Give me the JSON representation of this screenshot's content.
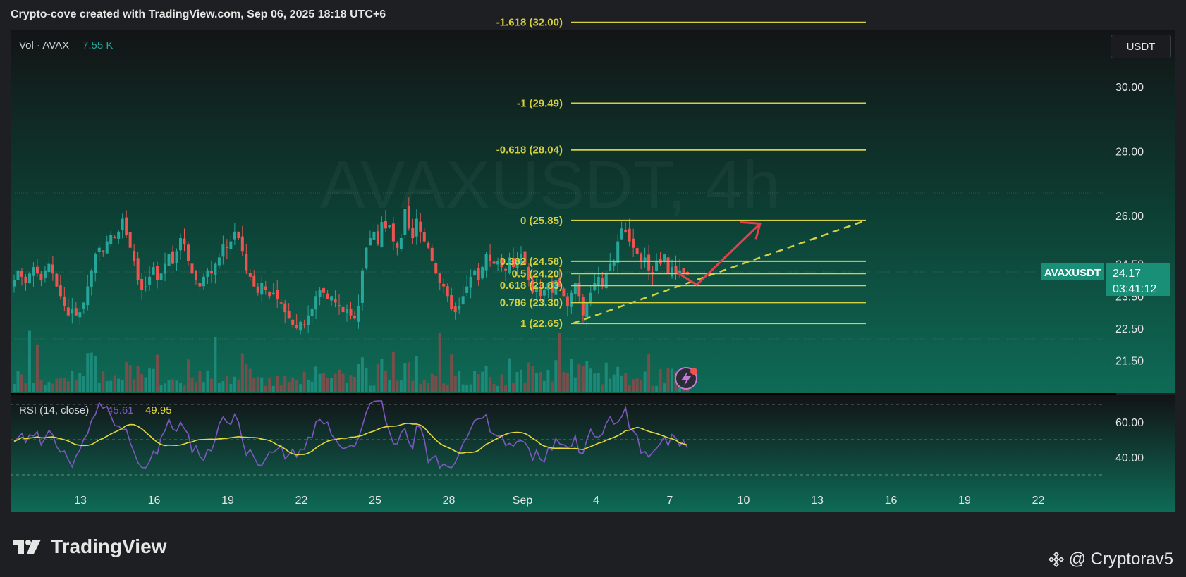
{
  "header": {
    "attribution": "Crypto-cove created with TradingView.com, Sep 06, 2025 18:18 UTC+6"
  },
  "toolbar": {
    "currency_label": "USDT"
  },
  "watermark": "AVAXUSDT, 4h",
  "colors": {
    "up": "#26a69a",
    "down": "#ef5350",
    "fib": "#d4d040",
    "fib_text": "#d4d040",
    "rsi_line": "#7e57c2",
    "rsi_ma": "#e5d83d",
    "bg_top": "#121314",
    "bg_bottom": "#0f6a55",
    "arrow": "#e0414b",
    "trend": "#d4d040"
  },
  "icons": [
    "tradingview-logo-icon",
    "binance-icon",
    "lightning-alert-icon"
  ],
  "chart_data": {
    "type": "candlestick",
    "symbol": "AVAXUSDT",
    "timeframe": "4h",
    "price_axis": {
      "ticks": [
        "30.00",
        "28.00",
        "26.00",
        "24.50",
        "23.50",
        "22.50",
        "21.50"
      ],
      "range": [
        20.9,
        32.8
      ]
    },
    "time_axis": {
      "ticks": [
        "13",
        "16",
        "19",
        "22",
        "25",
        "28",
        "Sep",
        "4",
        "7",
        "10",
        "13",
        "16",
        "19",
        "22"
      ]
    },
    "volume_legend": {
      "label": "Vol · AVAX",
      "value": "7.55 K"
    },
    "last_price": {
      "symbol_label": "AVAXUSDT",
      "price": "24.17",
      "countdown": "03:41:12"
    },
    "fib_levels": [
      {
        "label": "-1.618 (32.00)",
        "price": 32.0
      },
      {
        "label": "-1 (29.49)",
        "price": 29.49
      },
      {
        "label": "-0.618 (28.04)",
        "price": 28.04
      },
      {
        "label": "0 (25.85)",
        "price": 25.85
      },
      {
        "label": "0.382 (24.58)",
        "price": 24.58
      },
      {
        "label": "0.5 (24.20)",
        "price": 24.2
      },
      {
        "label": "0.618 (23.83)",
        "price": 23.83
      },
      {
        "label": "0.786 (23.30)",
        "price": 23.3
      },
      {
        "label": "1 (22.65)",
        "price": 22.65
      }
    ],
    "rsi": {
      "label": "RSI (14, close)",
      "value": "45.61",
      "ma_value": "49.95",
      "axis_ticks": [
        "60.00",
        "40.00"
      ],
      "bands": [
        70,
        50,
        30
      ]
    },
    "candles_close": [
      24.0,
      24.3,
      24.1,
      23.9,
      24.2,
      24.4,
      24.2,
      24.0,
      24.3,
      24.5,
      24.2,
      23.8,
      23.5,
      23.2,
      22.9,
      23.1,
      22.9,
      23.0,
      23.3,
      23.8,
      24.3,
      24.8,
      25.0,
      24.9,
      25.2,
      25.4,
      25.3,
      25.5,
      25.9,
      25.4,
      25.0,
      24.6,
      24.0,
      23.7,
      23.8,
      24.1,
      24.4,
      24.0,
      24.2,
      24.5,
      24.8,
      24.5,
      24.9,
      25.3,
      25.1,
      24.6,
      24.2,
      24.0,
      23.8,
      24.1,
      24.3,
      24.2,
      24.5,
      24.7,
      25.1,
      25.0,
      25.2,
      25.5,
      25.3,
      24.9,
      24.3,
      24.1,
      23.8,
      23.6,
      23.9,
      23.7,
      23.5,
      23.6,
      23.4,
      23.3,
      23.0,
      22.8,
      22.6,
      22.5,
      22.7,
      22.6,
      22.9,
      23.1,
      23.5,
      23.7,
      23.6,
      23.4,
      23.5,
      23.3,
      23.2,
      23.0,
      23.1,
      22.9,
      22.8,
      23.2,
      24.3,
      25.0,
      25.3,
      25.5,
      25.1,
      25.8,
      25.6,
      25.7,
      25.2,
      25.0,
      25.3,
      26.2,
      25.6,
      25.3,
      25.9,
      25.5,
      25.2,
      25.0,
      24.6,
      24.2,
      23.9,
      23.8,
      23.5,
      23.1,
      23.0,
      23.2,
      23.5,
      23.8,
      24.1,
      24.3,
      24.0,
      24.4,
      24.8,
      24.6,
      24.5,
      24.6,
      24.4,
      24.3,
      24.7,
      24.4,
      24.6,
      24.8,
      24.5,
      24.0,
      23.6,
      23.8,
      23.5,
      23.7,
      23.9,
      23.6,
      24.0,
      23.8,
      23.5,
      23.2,
      23.6,
      23.9,
      23.5,
      22.9,
      23.3,
      23.6,
      23.9,
      24.1,
      23.8,
      24.2,
      24.5,
      24.6,
      25.2,
      25.6,
      25.5,
      25.2,
      25.0,
      24.8,
      24.6,
      24.7,
      24.3,
      24.2,
      24.6,
      24.5,
      24.8,
      24.2,
      24.4,
      24.2,
      24.3,
      24.2,
      24.17
    ],
    "projection": {
      "trend_from": [
        22.65
      ],
      "trend_to": [
        25.85
      ],
      "arrow_via": [
        23.85
      ],
      "arrow_to": [
        25.75
      ]
    }
  },
  "footer": {
    "brand": "TradingView",
    "credit": "@ Cryptorav5"
  }
}
